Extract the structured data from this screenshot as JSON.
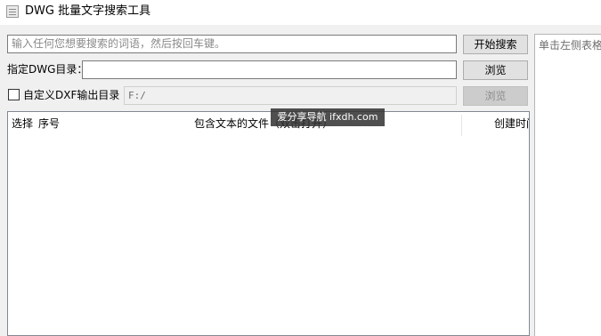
{
  "window": {
    "title": "DWG 批量文字搜索工具"
  },
  "search": {
    "placeholder": "输入任何您想要搜索的词语，然后按回车键。",
    "button_label": "开始搜索"
  },
  "directory": {
    "label": "指定DWG目录：",
    "value": "",
    "browse_label": "浏览"
  },
  "output": {
    "checkbox_label": "自定义DXF输出目录",
    "checked": false,
    "value": "F:/",
    "browse_label": "浏览"
  },
  "table": {
    "columns": [
      {
        "label": "选择"
      },
      {
        "label": "序号"
      },
      {
        "label": "包含文本的文件（双击打开）"
      },
      {
        "label": "创建时间"
      }
    ],
    "rows": []
  },
  "side_panel": {
    "hint": "单击左侧表格中的文件"
  },
  "watermark": {
    "text": "爱分享导航 ifxdh.com"
  }
}
